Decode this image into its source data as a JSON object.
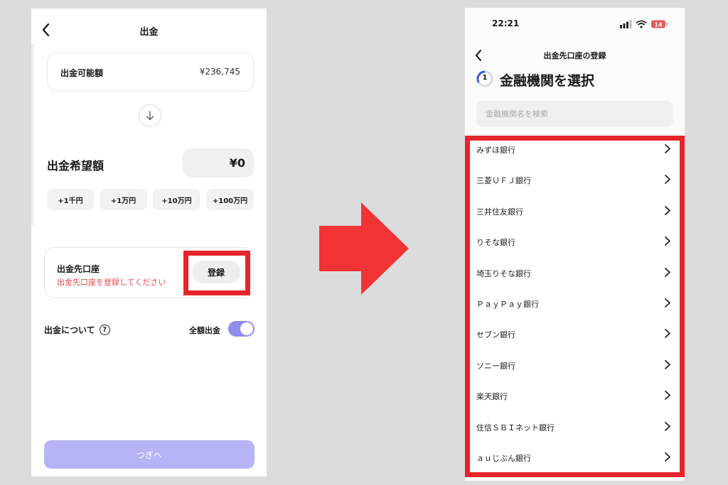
{
  "left": {
    "title": "出金",
    "available": {
      "label": "出金可能額",
      "value": "¥236,745"
    },
    "desired": {
      "label": "出金希望額",
      "value": "¥0"
    },
    "chips": [
      "+1千円",
      "+1万円",
      "+10万円",
      "+100万円"
    ],
    "destination": {
      "title": "出金先口座",
      "subtitle": "出金先口座を登録してください",
      "register_label": "登録"
    },
    "about_label": "出金について",
    "full_amount_label": "全額出金",
    "full_amount_on": true,
    "next_label": "つぎへ"
  },
  "right": {
    "status_time": "22:21",
    "battery": "14",
    "header_title": "出金先口座の登録",
    "step_number": "1",
    "heading": "金融機関を選択",
    "search_placeholder": "金融機関名を検索",
    "banks": [
      "みずほ銀行",
      "三菱ＵＦＪ銀行",
      "三井住友銀行",
      "りそな銀行",
      "埼玉りそな銀行",
      "ＰａｙＰａｙ銀行",
      "セブン銀行",
      "ソニー銀行",
      "楽天銀行",
      "住信ＳＢＩネット銀行",
      "ａｕじぶん銀行"
    ]
  },
  "colors": {
    "highlight_red": "#e6242c",
    "accent_purple": "#8f8df0",
    "button_disabled": "#b6b3f6",
    "error_text": "#e0494f",
    "background": "#dcdcdc"
  }
}
